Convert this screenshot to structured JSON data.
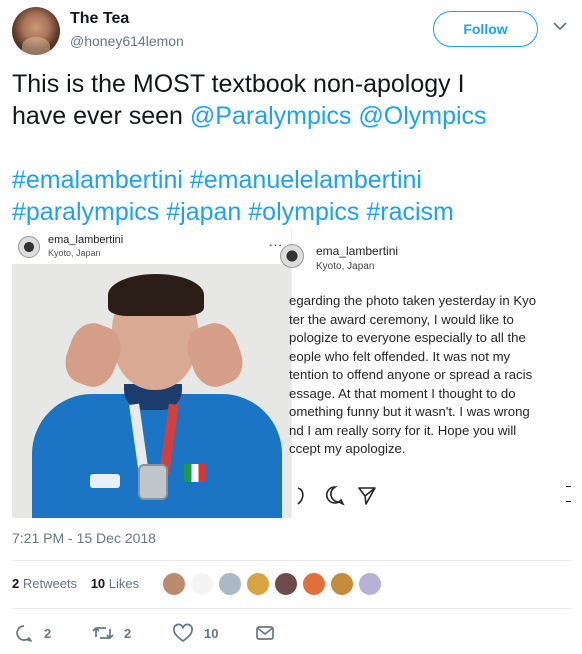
{
  "tweet": {
    "author_name": "The Tea",
    "author_handle": "@honey614lemon",
    "follow_label": "Follow",
    "text_plain_1": "This is the MOST textbook non-apology I",
    "text_plain_2": "have ever seen ",
    "mention_1": "@Paralympics",
    "mention_2": "@Olympics",
    "hashtag_1": "#emalambertini",
    "hashtag_2": "#emanuelelambertini",
    "hashtag_3": "#paralympics",
    "hashtag_4": "#japan",
    "hashtag_5": "#olympics",
    "hashtag_6": "#racism",
    "timestamp": "7:21 PM - 15 Dec 2018"
  },
  "media": {
    "left_post": {
      "username": "ema_lambertini",
      "location": "Kyoto, Japan",
      "more_dots": "..."
    },
    "right_post": {
      "username": "ema_lambertini",
      "location": "Kyoto, Japan",
      "caption_lines": [
        "egarding the photo taken yesterday in Kyo",
        "ter the award ceremony, I would like to",
        "pologize to everyone especially to all the",
        "eople who felt offended. It was not my",
        "tention to offend anyone or spread a racis",
        "essage. At that moment I thought to do",
        "omething funny but it wasn't. I was wrong",
        "nd I am really sorry for it. Hope you will",
        "ccept my apologize."
      ]
    }
  },
  "stats": {
    "retweets_count": "2",
    "retweets_label": "Retweets",
    "likes_count": "10",
    "likes_label": "Likes",
    "liker_avatar_colors": [
      "#b98a6e",
      "#f4f4f4",
      "#a9b8c4",
      "#d9a341",
      "#6d4b4b",
      "#e0703a",
      "#c58a3a",
      "#b7b1d9"
    ]
  },
  "actions": {
    "reply_count": "2",
    "retweet_count": "2",
    "like_count": "10"
  },
  "colors": {
    "accent": "#1da1f2",
    "muted": "#657786",
    "text": "#14171a"
  }
}
